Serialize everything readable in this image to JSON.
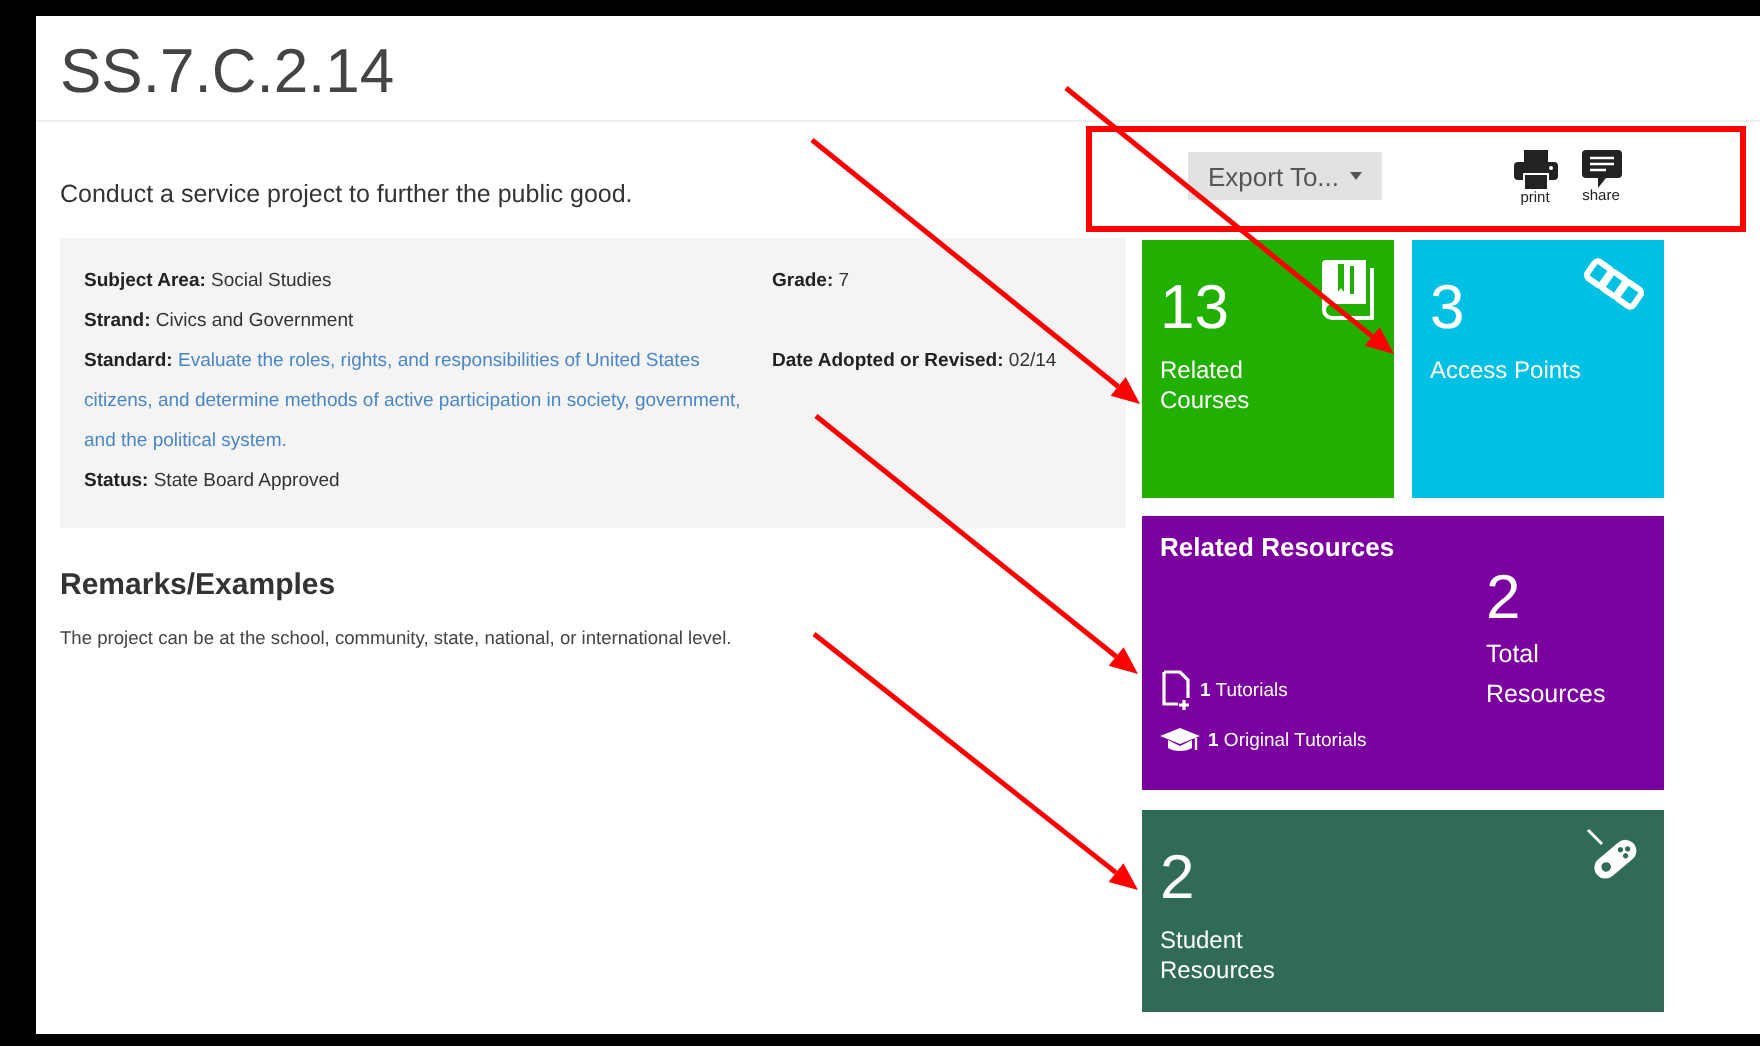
{
  "title": "SS.7.C.2.14",
  "description": "Conduct a service project to further the public good.",
  "toolbar": {
    "export_button": "Export To...",
    "actions": [
      {
        "kind": "print",
        "label": "print"
      },
      {
        "kind": "share",
        "label": "share"
      }
    ]
  },
  "details": {
    "left": [
      {
        "kind": "text",
        "label": "Subject Area:",
        "value": "Social Studies"
      },
      {
        "kind": "text",
        "label": "Strand:",
        "value": "Civics and Government"
      },
      {
        "kind": "link",
        "label": "Standard:",
        "value": "Evaluate the roles, rights, and responsibilities of United States citizens, and determine methods of active participation in society, government, and the political system."
      },
      {
        "kind": "text",
        "label": "Status:",
        "value": "State Board Approved"
      }
    ],
    "right": [
      {
        "label": "Grade:",
        "value": "7"
      },
      {
        "label": "Date Adopted or Revised:",
        "value": "02/14"
      }
    ]
  },
  "remarks": {
    "heading": "Remarks/Examples",
    "text": "The project can be at the school, community, state, national, or international level."
  },
  "tiles": [
    {
      "kind": "courses",
      "count": "13",
      "label": "Related Courses",
      "color": "#22b000"
    },
    {
      "kind": "access_points",
      "count": "3",
      "label": "Access Points",
      "color": "#00c0e4"
    },
    {
      "kind": "resources",
      "heading": "Related Resources",
      "items": [
        {
          "kind": "tutorial",
          "text": "**1** Tutorials"
        },
        {
          "kind": "original",
          "text": "**1** Original Tutorials"
        }
      ],
      "count": "2",
      "label": "Total Resources",
      "color": "#7b00a0"
    },
    {
      "kind": "student_resources",
      "count": "2",
      "label": "Student Resources",
      "color": "#2f6b55"
    }
  ],
  "annotations": [
    {
      "kind": "box"
    },
    {
      "kind": "arrow"
    },
    {
      "kind": "arrow"
    },
    {
      "kind": "arrow"
    },
    {
      "kind": "arrow"
    }
  ]
}
